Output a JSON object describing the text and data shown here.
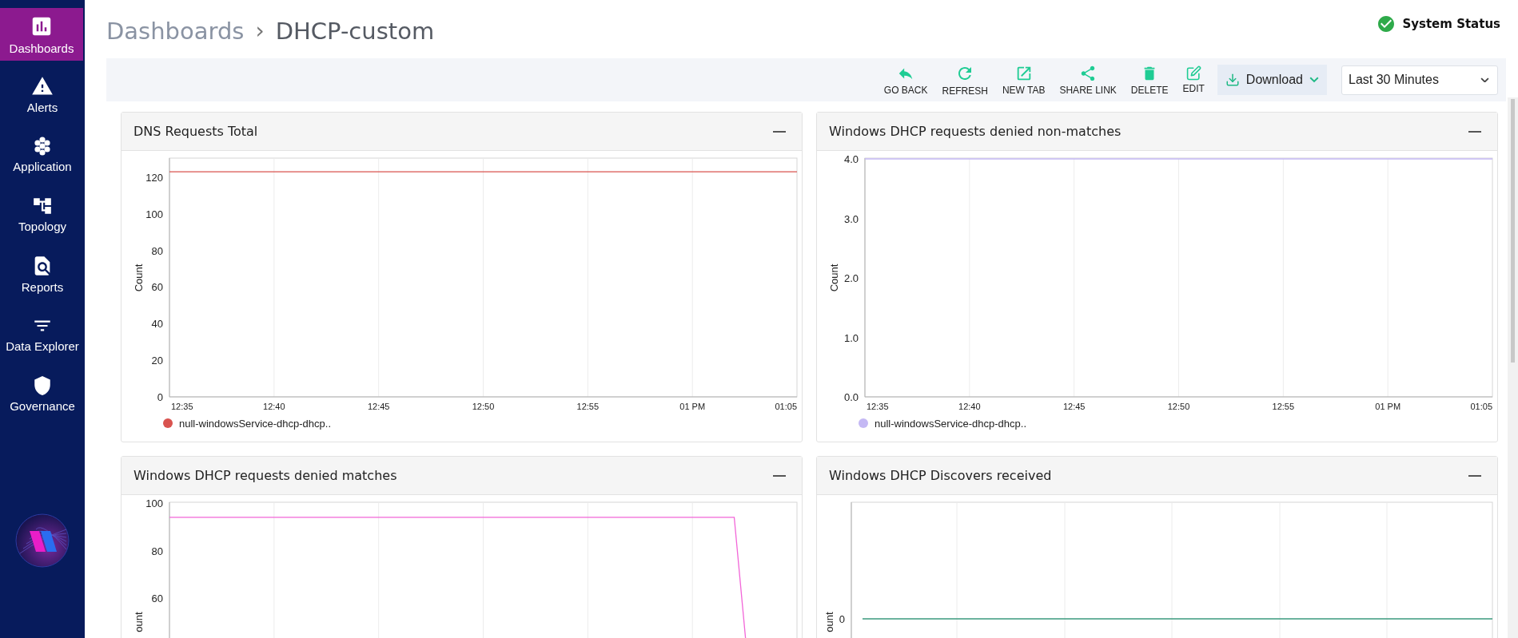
{
  "sidebar": {
    "items": [
      {
        "label": "Dashboards",
        "selected": true
      },
      {
        "label": "Alerts",
        "selected": false
      },
      {
        "label": "Application",
        "selected": false
      },
      {
        "label": "Topology",
        "selected": false
      },
      {
        "label": "Reports",
        "selected": false
      },
      {
        "label": "Data Explorer",
        "selected": false
      },
      {
        "label": "Governance",
        "selected": false
      }
    ]
  },
  "breadcrumb": {
    "parent": "Dashboards",
    "separator": "›",
    "current": "DHCP-custom"
  },
  "system_status": {
    "label": "System Status"
  },
  "toolbar": {
    "actions": [
      {
        "label": "GO BACK"
      },
      {
        "label": "REFRESH"
      },
      {
        "label": "NEW TAB"
      },
      {
        "label": "SHARE LINK"
      },
      {
        "label": "DELETE"
      },
      {
        "label": "EDIT"
      }
    ],
    "download": {
      "label": "Download"
    },
    "time_range": {
      "value": "Last 30 Minutes"
    }
  },
  "panels": [
    {
      "title": "DNS Requests Total",
      "chart_data": {
        "type": "line",
        "ylabel": "Count",
        "grid": true,
        "ylim": [
          0,
          130
        ],
        "categories": [
          "12:35",
          "12:40",
          "12:45",
          "12:50",
          "12:55",
          "01 PM",
          "01:05"
        ],
        "yticks": [
          0,
          20,
          40,
          60,
          80,
          100,
          120
        ],
        "series": [
          {
            "name": "null-windowsService-dhcp-dhcp..",
            "color": "#d9534f",
            "values": [
              123,
              123,
              123,
              123,
              123,
              123,
              123
            ]
          }
        ]
      }
    },
    {
      "title": "Windows DHCP requests denied non-matches",
      "chart_data": {
        "type": "line",
        "ylabel": "Count",
        "grid": true,
        "ylim": [
          0,
          4
        ],
        "categories": [
          "12:35",
          "12:40",
          "12:45",
          "12:50",
          "12:55",
          "01 PM",
          "01:05"
        ],
        "yticks": [
          {
            "value": 0,
            "label": "0.0"
          },
          {
            "value": 1,
            "label": "1.0"
          },
          {
            "value": 2,
            "label": "2.0"
          },
          {
            "value": 3,
            "label": "3.0"
          },
          {
            "value": 4,
            "label": "4.0"
          }
        ],
        "series": [
          {
            "name": "null-windowsService-dhcp-dhcp..",
            "color": "#c4b8f4",
            "values": [
              4,
              4,
              4,
              4,
              4,
              4,
              4
            ]
          }
        ]
      }
    },
    {
      "title": "Windows DHCP requests denied matches",
      "chart_data": {
        "type": "line",
        "ylabel": "ount",
        "grid": true,
        "ylim": [
          0,
          100
        ],
        "categories": [
          null,
          null,
          null,
          null,
          null,
          null,
          null,
          null,
          null,
          null,
          null,
          null,
          null,
          null,
          null,
          null,
          null,
          null,
          null,
          null,
          null,
          null,
          null,
          null,
          null,
          null,
          null,
          null,
          null,
          null,
          null
        ],
        "yticks": [
          60,
          80,
          100
        ],
        "series": [
          {
            "color": "#f266d8",
            "values": [
              94,
              94,
              94,
              94,
              94,
              94,
              94,
              94,
              94,
              94,
              94,
              94,
              94,
              94,
              94,
              94,
              94,
              94,
              94,
              94,
              94,
              94,
              94,
              94,
              94,
              94,
              94,
              94,
              0,
              null,
              null
            ]
          }
        ]
      }
    },
    {
      "title": "Windows DHCP Discovers received",
      "y_label": "ount",
      "y_tick_label": "0"
    }
  ]
}
